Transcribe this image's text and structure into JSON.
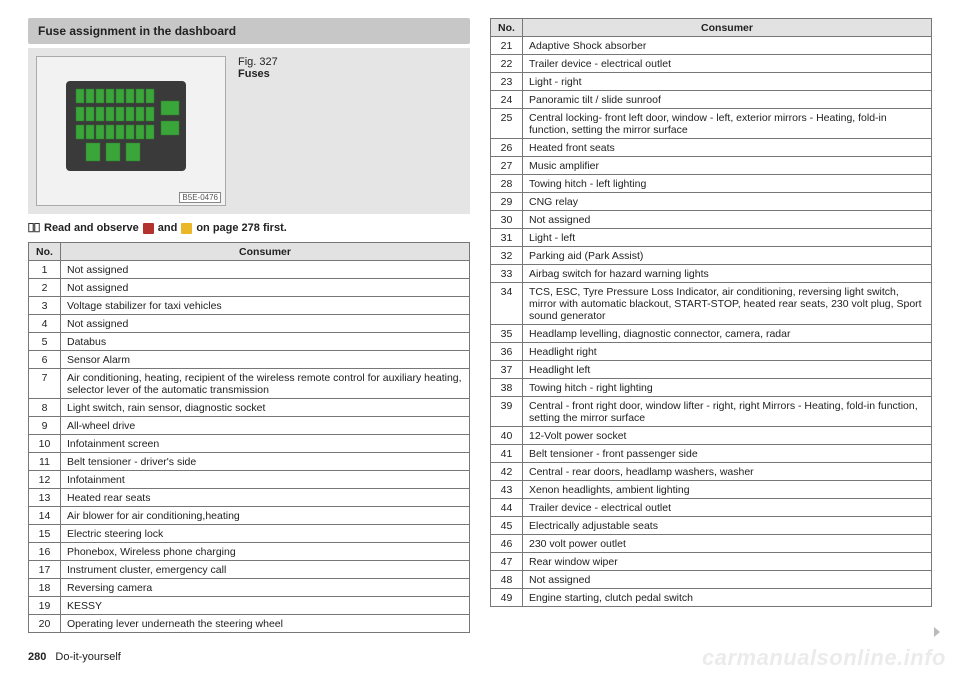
{
  "section_title": "Fuse assignment in the dashboard",
  "figure": {
    "number": "Fig. 327",
    "title": "Fuses",
    "code": "B5E-0476"
  },
  "observe": {
    "prefix": "Read and observe",
    "mid": "and",
    "suffix": "on page 278 first."
  },
  "headers": {
    "no": "No.",
    "consumer": "Consumer"
  },
  "table_left": [
    {
      "no": "1",
      "c": "Not assigned"
    },
    {
      "no": "2",
      "c": "Not assigned"
    },
    {
      "no": "3",
      "c": "Voltage stabilizer for taxi vehicles"
    },
    {
      "no": "4",
      "c": "Not assigned"
    },
    {
      "no": "5",
      "c": "Databus"
    },
    {
      "no": "6",
      "c": "Sensor Alarm"
    },
    {
      "no": "7",
      "c": "Air conditioning, heating, recipient of the wireless remote control for auxiliary heating, selector lever of the automatic transmission"
    },
    {
      "no": "8",
      "c": "Light switch, rain sensor, diagnostic socket"
    },
    {
      "no": "9",
      "c": "All-wheel drive"
    },
    {
      "no": "10",
      "c": "Infotainment screen"
    },
    {
      "no": "11",
      "c": "Belt tensioner - driver's side"
    },
    {
      "no": "12",
      "c": "Infotainment"
    },
    {
      "no": "13",
      "c": "Heated rear seats"
    },
    {
      "no": "14",
      "c": "Air blower for air conditioning,heating"
    },
    {
      "no": "15",
      "c": "Electric steering lock"
    },
    {
      "no": "16",
      "c": "Phonebox, Wireless phone charging"
    },
    {
      "no": "17",
      "c": "Instrument cluster, emergency call"
    },
    {
      "no": "18",
      "c": "Reversing camera"
    },
    {
      "no": "19",
      "c": "KESSY"
    },
    {
      "no": "20",
      "c": "Operating lever underneath the steering wheel"
    }
  ],
  "table_right": [
    {
      "no": "21",
      "c": "Adaptive Shock absorber"
    },
    {
      "no": "22",
      "c": "Trailer device - electrical outlet"
    },
    {
      "no": "23",
      "c": "Light - right"
    },
    {
      "no": "24",
      "c": "Panoramic tilt / slide sunroof"
    },
    {
      "no": "25",
      "c": "Central locking- front left door, window - left, exterior mirrors - Heating, fold-in function, setting the mirror surface"
    },
    {
      "no": "26",
      "c": "Heated front seats"
    },
    {
      "no": "27",
      "c": "Music amplifier"
    },
    {
      "no": "28",
      "c": "Towing hitch - left lighting"
    },
    {
      "no": "29",
      "c": "CNG relay"
    },
    {
      "no": "30",
      "c": "Not assigned"
    },
    {
      "no": "31",
      "c": "Light - left"
    },
    {
      "no": "32",
      "c": "Parking aid (Park Assist)"
    },
    {
      "no": "33",
      "c": "Airbag switch for hazard warning lights"
    },
    {
      "no": "34",
      "c": "TCS, ESC, Tyre Pressure Loss Indicator, air conditioning, reversing light switch, mirror with automatic blackout, START-STOP, heated rear seats, 230 volt plug, Sport sound generator"
    },
    {
      "no": "35",
      "c": "Headlamp levelling, diagnostic connector, camera, radar"
    },
    {
      "no": "36",
      "c": "Headlight right"
    },
    {
      "no": "37",
      "c": "Headlight left"
    },
    {
      "no": "38",
      "c": "Towing hitch - right lighting"
    },
    {
      "no": "39",
      "c": "Central - front right door, window lifter - right, right Mirrors - Heating, fold-in function, setting the mirror surface"
    },
    {
      "no": "40",
      "c": "12-Volt power socket"
    },
    {
      "no": "41",
      "c": "Belt tensioner - front passenger side"
    },
    {
      "no": "42",
      "c": "Central - rear doors, headlamp washers, washer"
    },
    {
      "no": "43",
      "c": "Xenon headlights, ambient lighting"
    },
    {
      "no": "44",
      "c": "Trailer device - electrical outlet"
    },
    {
      "no": "45",
      "c": "Electrically adjustable seats"
    },
    {
      "no": "46",
      "c": "230 volt power outlet"
    },
    {
      "no": "47",
      "c": "Rear window wiper"
    },
    {
      "no": "48",
      "c": "Not assigned"
    },
    {
      "no": "49",
      "c": "Engine starting, clutch pedal switch"
    }
  ],
  "footer": {
    "page": "280",
    "section": "Do-it-yourself"
  },
  "watermark": "carmanualsonline.info"
}
